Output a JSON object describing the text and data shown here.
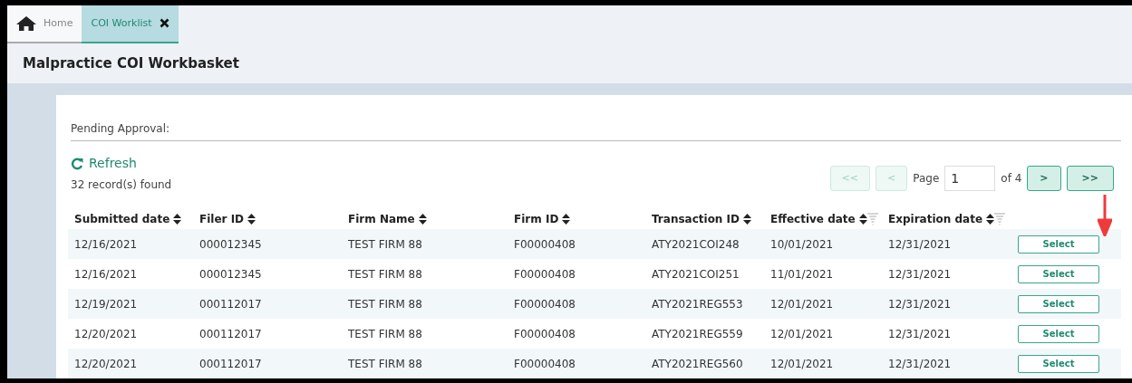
{
  "tabs": [
    {
      "label": "Home",
      "kind": "home",
      "selected": false
    },
    {
      "label": "COI Worklist",
      "kind": "closable",
      "selected": true
    }
  ],
  "page_title": "Malpractice COI Workbasket",
  "section_label": "Pending Approval:",
  "refresh": "Refresh",
  "record_count": "32 record(s) found",
  "pagination": {
    "buttons": [
      {
        "label": "<<",
        "disabled": true
      },
      {
        "label": "<",
        "disabled": true
      },
      {
        "label": ">",
        "disabled": false
      },
      {
        "label": ">>",
        "disabled": false
      }
    ],
    "page_label": "Page",
    "page_value": "1",
    "of_label": "of 4"
  },
  "table": {
    "columns": [
      {
        "label": "Submitted date",
        "filter": false
      },
      {
        "label": "Filer ID",
        "filter": false
      },
      {
        "label": "Firm Name",
        "filter": false
      },
      {
        "label": "Firm ID",
        "filter": false
      },
      {
        "label": "Transaction ID",
        "filter": false
      },
      {
        "label": "Effective date",
        "filter": true
      },
      {
        "label": "Expiration date",
        "filter": true
      }
    ],
    "rows": [
      {
        "cells": [
          "12/16/2021",
          "000012345",
          "TEST FIRM 88",
          "F00000408",
          "ATY2021COI248",
          "10/01/2021",
          "12/31/2021"
        ],
        "action": "Select"
      },
      {
        "cells": [
          "12/16/2021",
          "000012345",
          "TEST FIRM 88",
          "F00000408",
          "ATY2021COI251",
          "11/01/2021",
          "12/31/2021"
        ],
        "action": "Select"
      },
      {
        "cells": [
          "12/19/2021",
          "000112017",
          "TEST FIRM 88",
          "F00000408",
          "ATY2021REG553",
          "12/01/2021",
          "12/31/2021"
        ],
        "action": "Select"
      },
      {
        "cells": [
          "12/20/2021",
          "000112017",
          "TEST FIRM 88",
          "F00000408",
          "ATY2021REG559",
          "12/01/2021",
          "12/31/2021"
        ],
        "action": "Select"
      },
      {
        "cells": [
          "12/20/2021",
          "000112017",
          "TEST FIRM 88",
          "F00000408",
          "ATY2021REG560",
          "12/01/2021",
          "12/31/2021"
        ],
        "action": "Select"
      }
    ]
  }
}
